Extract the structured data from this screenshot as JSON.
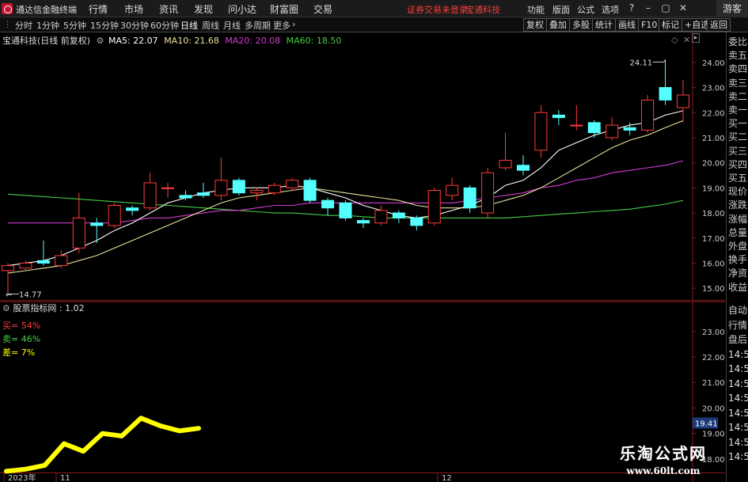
{
  "app": {
    "title": "通达信金融终端"
  },
  "menu": {
    "items": [
      "行情",
      "市场",
      "资讯",
      "发现",
      "问小达",
      "财富圈",
      "交易"
    ],
    "notice": "证券交易未登录",
    "stock": "宝通科技",
    "right_items": [
      "功能",
      "版面",
      "公式",
      "选项"
    ],
    "guest": "游客"
  },
  "periods": {
    "items": [
      "分时",
      "1分钟",
      "5分钟",
      "15分钟",
      "30分钟",
      "60分钟",
      "日线",
      "周线",
      "月线",
      "多周期",
      "更多"
    ],
    "active": "日线",
    "right_buttons": [
      "复权",
      "叠加",
      "多股",
      "统计",
      "画线",
      "F10",
      "标记",
      "+自选",
      "返回"
    ]
  },
  "main_legend": {
    "stock_label": "宝通科技(日线 前复权)",
    "ma5": "MA5: 22.07",
    "ma10": "MA10: 21.68",
    "ma20": "MA20: 20.08",
    "ma60": "MA60: 18.50"
  },
  "sub_legend": {
    "title": "股票指标网 : 1.02",
    "buy": "买= 54%",
    "sell": "卖= 46%",
    "diff": "差= 7%"
  },
  "right_panel": {
    "top": [
      "委比",
      "卖五",
      "卖四",
      "卖三",
      "卖二",
      "卖一",
      "买一",
      "买二",
      "买三",
      "买四",
      "买五",
      "现价",
      "涨跌",
      "涨幅",
      "总量",
      "外盘",
      "换手",
      "净资",
      "收益"
    ],
    "bottom": [
      "自动",
      "行情",
      "盘后",
      "14:5",
      "14:5",
      "14:5",
      "14:5",
      "14:5",
      "14:5",
      "14:5",
      "14:5"
    ]
  },
  "price_axis": [
    "24.00",
    "23.00",
    "22.00",
    "21.00",
    "20.00",
    "19.00",
    "18.00",
    "17.00",
    "16.00",
    "15.00"
  ],
  "sub_axis": [
    "23.00",
    "22.00",
    "21.00",
    "20.00",
    "19.00",
    "18.00"
  ],
  "current_price_tag": "19.41",
  "time_axis": [
    "2023年",
    "11",
    "12"
  ],
  "annotations": {
    "high": "24.11",
    "low": "14.77"
  },
  "watermark": {
    "big": "乐淘公式网",
    "small": "www.60lt.com"
  },
  "colors": {
    "up": "#ff3b3b",
    "down": "#54ffff",
    "ma5": "#ffffff",
    "ma10": "#e8e09a",
    "ma20": "#d23ad2",
    "ma60": "#44cc44",
    "indicator": "#ffff00"
  },
  "chart_data": {
    "type": "candlestick",
    "price_range": [
      14.5,
      24.5
    ],
    "candles": [
      {
        "o": 15.7,
        "c": 15.9,
        "h": 16.0,
        "l": 14.77
      },
      {
        "o": 15.8,
        "c": 16.0,
        "h": 16.1,
        "l": 15.7
      },
      {
        "o": 16.1,
        "c": 16.0,
        "h": 16.9,
        "l": 15.9
      },
      {
        "o": 15.9,
        "c": 16.3,
        "h": 16.5,
        "l": 15.8
      },
      {
        "o": 16.6,
        "c": 17.8,
        "h": 18.8,
        "l": 16.4
      },
      {
        "o": 17.6,
        "c": 17.5,
        "h": 17.8,
        "l": 16.8
      },
      {
        "o": 17.5,
        "c": 18.3,
        "h": 18.4,
        "l": 17.4
      },
      {
        "o": 18.2,
        "c": 18.1,
        "h": 18.3,
        "l": 17.9
      },
      {
        "o": 18.2,
        "c": 19.2,
        "h": 19.6,
        "l": 18.1
      },
      {
        "o": 19.0,
        "c": 19.0,
        "h": 19.2,
        "l": 18.6
      },
      {
        "o": 18.7,
        "c": 18.6,
        "h": 18.9,
        "l": 18.5
      },
      {
        "o": 18.8,
        "c": 18.7,
        "h": 19.2,
        "l": 18.6
      },
      {
        "o": 18.7,
        "c": 19.3,
        "h": 20.2,
        "l": 18.5
      },
      {
        "o": 19.3,
        "c": 18.8,
        "h": 19.4,
        "l": 18.7
      },
      {
        "o": 18.8,
        "c": 18.9,
        "h": 19.0,
        "l": 18.5
      },
      {
        "o": 18.8,
        "c": 19.1,
        "h": 19.2,
        "l": 18.7
      },
      {
        "o": 19.0,
        "c": 19.3,
        "h": 19.4,
        "l": 18.9
      },
      {
        "o": 19.3,
        "c": 18.5,
        "h": 19.4,
        "l": 18.4
      },
      {
        "o": 18.5,
        "c": 18.2,
        "h": 18.6,
        "l": 17.9
      },
      {
        "o": 18.4,
        "c": 17.8,
        "h": 18.5,
        "l": 17.7
      },
      {
        "o": 17.7,
        "c": 17.6,
        "h": 17.8,
        "l": 17.4
      },
      {
        "o": 17.6,
        "c": 18.1,
        "h": 18.3,
        "l": 17.5
      },
      {
        "o": 18.0,
        "c": 17.8,
        "h": 18.1,
        "l": 17.6
      },
      {
        "o": 17.8,
        "c": 17.5,
        "h": 17.9,
        "l": 17.3
      },
      {
        "o": 17.6,
        "c": 18.9,
        "h": 19.0,
        "l": 17.5
      },
      {
        "o": 18.7,
        "c": 19.1,
        "h": 19.4,
        "l": 18.5
      },
      {
        "o": 19.0,
        "c": 18.2,
        "h": 19.1,
        "l": 18.0
      },
      {
        "o": 18.0,
        "c": 19.6,
        "h": 19.8,
        "l": 17.8
      },
      {
        "o": 19.8,
        "c": 20.1,
        "h": 21.2,
        "l": 19.7
      },
      {
        "o": 19.9,
        "c": 19.7,
        "h": 20.3,
        "l": 19.5
      },
      {
        "o": 20.5,
        "c": 22.0,
        "h": 22.3,
        "l": 20.2
      },
      {
        "o": 21.9,
        "c": 21.8,
        "h": 22.1,
        "l": 21.5
      },
      {
        "o": 21.5,
        "c": 21.5,
        "h": 22.3,
        "l": 21.3
      },
      {
        "o": 21.6,
        "c": 21.2,
        "h": 21.7,
        "l": 21.0
      },
      {
        "o": 21.0,
        "c": 21.5,
        "h": 21.8,
        "l": 20.9
      },
      {
        "o": 21.4,
        "c": 21.3,
        "h": 21.6,
        "l": 21.1
      },
      {
        "o": 21.3,
        "c": 22.5,
        "h": 22.7,
        "l": 21.2
      },
      {
        "o": 23.0,
        "c": 22.5,
        "h": 24.11,
        "l": 22.3
      },
      {
        "o": 22.2,
        "c": 22.7,
        "h": 23.3,
        "l": 21.6
      }
    ],
    "ma5": [
      15.9,
      16.0,
      16.1,
      16.3,
      16.6,
      16.9,
      17.3,
      17.6,
      18.0,
      18.4,
      18.6,
      18.8,
      18.9,
      19.0,
      19.0,
      19.0,
      19.1,
      19.0,
      18.8,
      18.6,
      18.3,
      18.1,
      17.9,
      17.8,
      17.9,
      18.1,
      18.3,
      18.6,
      19.1,
      19.3,
      19.8,
      20.5,
      20.8,
      21.1,
      21.3,
      21.5,
      21.6,
      21.9,
      22.07
    ],
    "ma10": [
      15.6,
      15.7,
      15.8,
      15.9,
      16.1,
      16.3,
      16.6,
      16.9,
      17.2,
      17.5,
      17.8,
      18.1,
      18.4,
      18.6,
      18.7,
      18.8,
      18.9,
      19.0,
      18.9,
      18.8,
      18.7,
      18.6,
      18.5,
      18.3,
      18.2,
      18.2,
      18.2,
      18.3,
      18.5,
      18.7,
      19.0,
      19.4,
      19.8,
      20.2,
      20.6,
      20.9,
      21.1,
      21.4,
      21.68
    ],
    "ma20": [
      17.6,
      17.6,
      17.6,
      17.6,
      17.6,
      17.6,
      17.6,
      17.7,
      17.8,
      17.8,
      17.9,
      18.0,
      18.1,
      18.1,
      18.2,
      18.3,
      18.3,
      18.4,
      18.4,
      18.4,
      18.4,
      18.4,
      18.4,
      18.4,
      18.4,
      18.4,
      18.5,
      18.6,
      18.7,
      18.8,
      19.0,
      19.1,
      19.3,
      19.4,
      19.6,
      19.7,
      19.8,
      19.9,
      20.08
    ],
    "ma60": [
      18.75,
      18.7,
      18.65,
      18.6,
      18.55,
      18.5,
      18.45,
      18.4,
      18.35,
      18.3,
      18.25,
      18.2,
      18.15,
      18.1,
      18.05,
      18.0,
      18.0,
      17.95,
      17.9,
      17.9,
      17.85,
      17.8,
      17.8,
      17.8,
      17.8,
      17.8,
      17.8,
      17.8,
      17.8,
      17.85,
      17.9,
      17.95,
      18.0,
      18.05,
      18.1,
      18.15,
      18.25,
      18.35,
      18.5
    ],
    "indicator_range": [
      17.5,
      23.8
    ],
    "indicator": [
      17.52,
      17.6,
      17.75,
      18.6,
      18.3,
      19.0,
      18.9,
      19.6,
      19.3,
      19.1,
      19.2
    ]
  }
}
